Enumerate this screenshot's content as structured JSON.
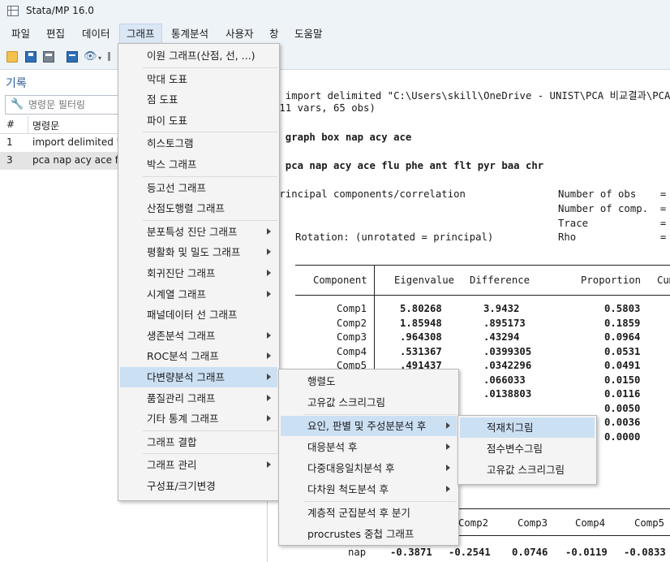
{
  "window": {
    "title": "Stata/MP 16.0"
  },
  "menubar": [
    {
      "label": "파일"
    },
    {
      "label": "편집"
    },
    {
      "label": "데이터"
    },
    {
      "label": "그래프"
    },
    {
      "label": "통계분석"
    },
    {
      "label": "사용자"
    },
    {
      "label": "창"
    },
    {
      "label": "도움말"
    }
  ],
  "toolbar": {
    "icons": [
      "open-icon",
      "save-icon",
      "print-icon",
      "log-icon",
      "viewer-icon",
      "graph-icon"
    ]
  },
  "history": {
    "title": "기록",
    "filter_placeholder": "명령문 필터링",
    "col_num": "#",
    "col_cmd": "명령문",
    "rows": [
      {
        "num": "1",
        "cmd": "import delimited \"C"
      },
      {
        "num": "3",
        "cmd": "pca nap acy ace flu"
      }
    ]
  },
  "results": {
    "line1": ". import delimited \"C:\\Users\\skill\\OneDrive - UNIST\\PCA 비교결과\\PCA",
    "line2": "(11 vars, 65 obs)",
    "line3": ". graph box nap acy ace",
    "line4": ". pca nap acy ace flu phe ant flt pyr baa chr",
    "line5": "Principal components/correlation",
    "stat1": "Number of obs    =",
    "stat2": "Number of comp.  =",
    "stat3": "Trace            =",
    "stat4": "Rho              =",
    "rotation": "Rotation: (unrotated = principal)",
    "eig_header": {
      "component": "Component",
      "eigenvalue": "Eigenvalue",
      "difference": "Difference",
      "proportion": "Proportion",
      "cum": "Cum"
    },
    "eig_rows": [
      {
        "comp": "Comp1",
        "eig": "5.80268",
        "diff": "3.9432",
        "prop": "0.5803"
      },
      {
        "comp": "Comp2",
        "eig": "1.85948",
        "diff": ".895173",
        "prop": "0.1859"
      },
      {
        "comp": "Comp3",
        "eig": ".964308",
        "diff": ".43294",
        "prop": "0.0964"
      },
      {
        "comp": "Comp4",
        "eig": ".531367",
        "diff": ".0399305",
        "prop": "0.0531"
      },
      {
        "comp": "Comp5",
        "eig": ".491437",
        "diff": ".0342296",
        "prop": "0.0491"
      },
      {
        "comp": "",
        "eig": "",
        "diff": ".066033",
        "prop": "0.0150"
      },
      {
        "comp": "",
        "eig": "",
        "diff": ".0138803",
        "prop": "0.0116"
      },
      {
        "comp": "",
        "eig": "",
        "diff": "",
        "prop": "0.0050"
      },
      {
        "comp": "",
        "eig": "",
        "diff": "",
        "prop": "0.0036"
      },
      {
        "comp": "",
        "eig": "",
        "diff": "",
        "prop": "0.0000"
      }
    ],
    "load_header": {
      "c2": "Comp2",
      "c3": "Comp3",
      "c4": "Comp4",
      "c5": "Comp5"
    },
    "load_row": {
      "var": "nap",
      "c1": "-0.3871",
      "c2": "-0.2541",
      "c3": "0.0746",
      "c4": "-0.0119",
      "c5": "-0.0833"
    }
  },
  "graph_menu": [
    {
      "label": "이원 그래프(산점, 선, ...)",
      "sub": false
    },
    {
      "label": "막대 도표",
      "sub": false
    },
    {
      "label": "점 도표",
      "sub": false
    },
    {
      "label": "파이 도표",
      "sub": false
    },
    {
      "label": "히스토그램",
      "sub": false
    },
    {
      "label": "박스 그래프",
      "sub": false
    },
    {
      "label": "등고선 그래프",
      "sub": false
    },
    {
      "label": "산점도행렬 그래프",
      "sub": false
    },
    {
      "label": "분포특성 진단 그래프",
      "sub": true
    },
    {
      "label": "평활화 및 밀도 그래프",
      "sub": true
    },
    {
      "label": "회귀진단 그래프",
      "sub": true
    },
    {
      "label": "시계열 그래프",
      "sub": true
    },
    {
      "label": "패널데이터 선 그래프",
      "sub": false
    },
    {
      "label": "생존분석 그래프",
      "sub": true
    },
    {
      "label": "ROC분석 그래프",
      "sub": true
    },
    {
      "label": "다변량분석 그래프",
      "sub": true
    },
    {
      "label": "품질관리 그래프",
      "sub": true
    },
    {
      "label": "기타 통계 그래프",
      "sub": true
    },
    {
      "label": "그래프 결합",
      "sub": false
    },
    {
      "label": "그래프 관리",
      "sub": true
    },
    {
      "label": "구성표/크기변경",
      "sub": false
    }
  ],
  "multivariate_menu": [
    {
      "label": "행렬도",
      "sub": false
    },
    {
      "label": "고유값 스크리그림",
      "sub": false
    },
    {
      "label": "요인, 판별 및 주성분분석 후",
      "sub": true
    },
    {
      "label": "대응분석 후",
      "sub": true
    },
    {
      "label": "다중대응일치분석 후",
      "sub": true
    },
    {
      "label": "다차원 척도분석 후",
      "sub": true
    },
    {
      "label": "계층적 군집분석 후 분기",
      "sub": false
    },
    {
      "label": "procrustes 중첩 그래프",
      "sub": false
    }
  ],
  "factor_menu": [
    {
      "label": "적재치그림"
    },
    {
      "label": "점수변수그림"
    },
    {
      "label": "고유값 스크리그림"
    }
  ]
}
